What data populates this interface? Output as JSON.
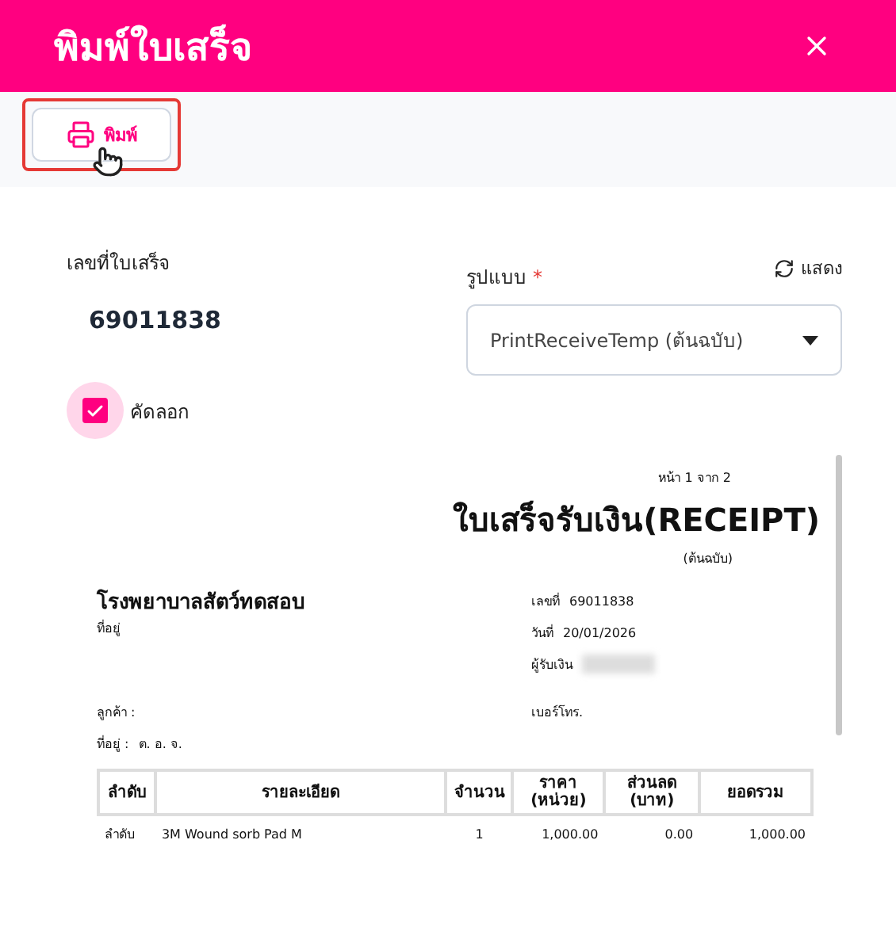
{
  "window": {
    "title": "พิมพ์ใบเสร็จ"
  },
  "toolbar": {
    "print_button": {
      "label": "พิมพ์",
      "highlighted": true
    }
  },
  "form": {
    "receipt_no_label": "เลขที่ใบเสร็จ",
    "receipt_no": "69011838",
    "format_label": "รูปแบบ",
    "required_mark": "*",
    "refresh_label": "แสดง",
    "format_value": "PrintReceiveTemp (ต้นฉบับ)",
    "copy": {
      "label": "คัดลอก",
      "checked": true
    }
  },
  "preview": {
    "page": "หน้า 1 จาก 2",
    "title": "ใบเสร็จรับเงิน(RECEIPT)",
    "subtitle": "(ต้นฉบับ)",
    "company": "โรงพยาบาลสัตว์ทดสอบ",
    "company_address": "ที่อยู่",
    "no_label": "เลขที่",
    "no": "69011838",
    "date_label": "วันที่",
    "date": "20/01/2026",
    "cashier_label": "ผู้รับเงิน",
    "customer_label": "ลูกค้า :",
    "phone_label": "เบอร์โทร.",
    "address_label": "ที่อยู่ :",
    "address": "ต. อ. จ.",
    "columns": [
      "ลำดับ",
      "รายละเอียด",
      "จำนวน",
      "ราคา (หน่วย)",
      "ส่วนลด (บาท)",
      "ยอดรวม"
    ],
    "rows": [
      [
        "ลำดับ",
        "3M Wound sorb Pad M",
        "1",
        "1,000.00",
        "0.00",
        "1,000.00"
      ]
    ]
  }
}
